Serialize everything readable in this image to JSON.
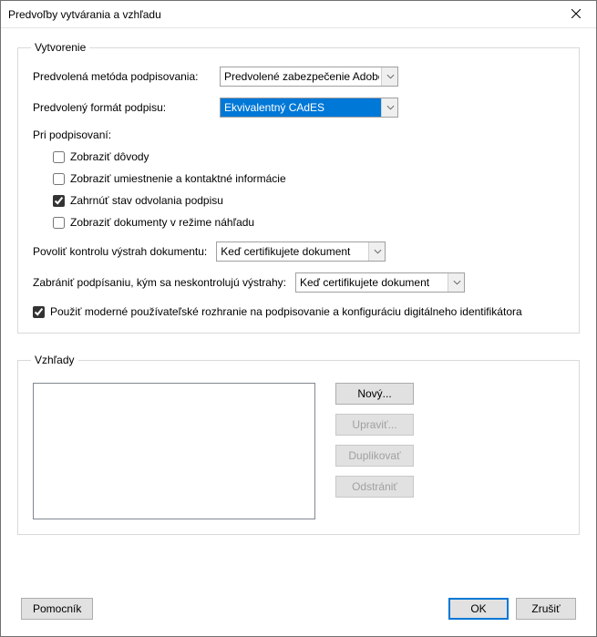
{
  "window": {
    "title": "Predvoľby vytvárania a vzhľadu"
  },
  "creation": {
    "legend": "Vytvorenie",
    "default_method_label": "Predvolená metóda podpisovania:",
    "default_method_value": "Predvolené zabezpečenie Adobe",
    "default_format_label": "Predvolený formát podpisu:",
    "default_format_value": "Ekvivalentný CAdES",
    "when_signing_label": "Pri podpisovaní:",
    "checks": {
      "reasons": {
        "label": "Zobraziť dôvody",
        "checked": false
      },
      "location": {
        "label": "Zobraziť umiestnenie a kontaktné informácie",
        "checked": false
      },
      "revocation": {
        "label": "Zahrnúť stav odvolania podpisu",
        "checked": true
      },
      "preview": {
        "label": "Zobraziť dokumenty v režime náhľadu",
        "checked": false
      }
    },
    "allow_warnings_label": "Povoliť kontrolu výstrah dokumentu:",
    "allow_warnings_value": "Keď certifikujete dokument",
    "prevent_signing_label": "Zabrániť podpísaniu, kým sa neskontrolujú výstrahy:",
    "prevent_signing_value": "Keď certifikujete dokument",
    "modern_ui": {
      "label": "Použiť moderné používateľské rozhranie na podpisovanie a konfiguráciu digitálneho identifikátora",
      "checked": true
    }
  },
  "appearances": {
    "legend": "Vzhľady",
    "buttons": {
      "new": "Nový...",
      "edit": "Upraviť...",
      "duplicate": "Duplikovať",
      "delete": "Odstrániť"
    }
  },
  "footer": {
    "help": "Pomocník",
    "ok": "OK",
    "cancel": "Zrušiť"
  }
}
